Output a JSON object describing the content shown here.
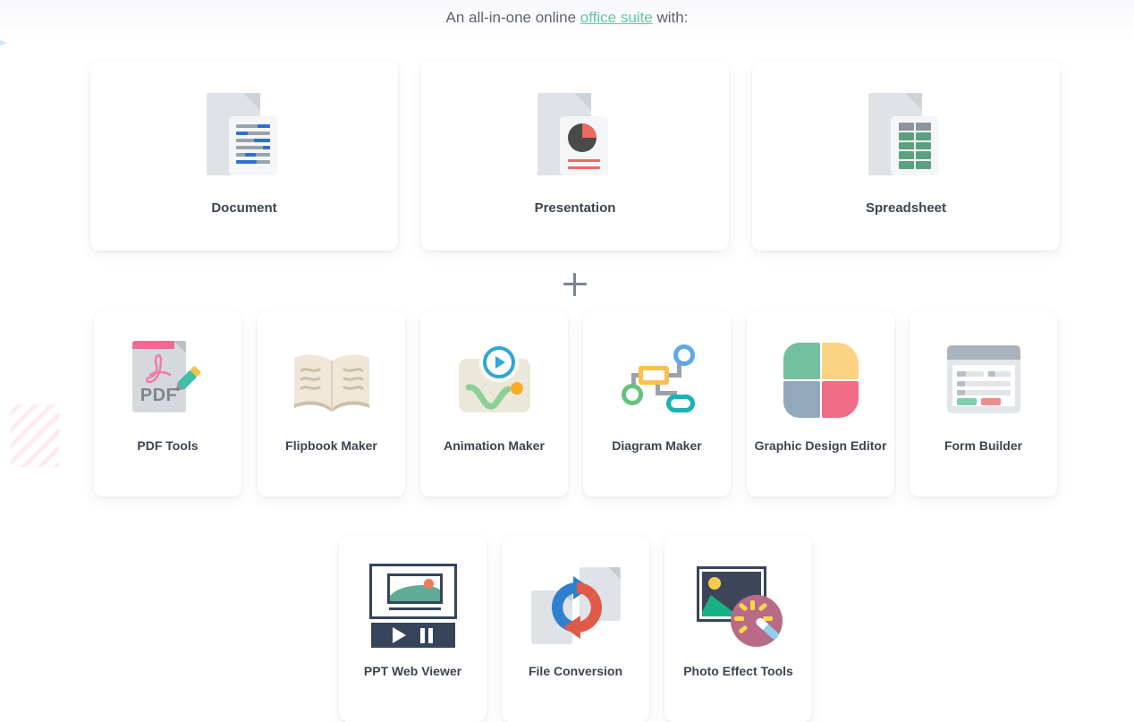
{
  "headline": {
    "prefix": "An all-in-one online ",
    "link": "office suite",
    "suffix": " with:"
  },
  "divider": {
    "plus_label": "+"
  },
  "primary_apps": [
    {
      "label": "Document",
      "icon": "document-icon"
    },
    {
      "label": "Presentation",
      "icon": "presentation-icon"
    },
    {
      "label": "Spreadsheet",
      "icon": "spreadsheet-icon"
    }
  ],
  "tool_apps": [
    {
      "label": "PDF Tools",
      "icon": "pdf-tools-icon"
    },
    {
      "label": "Flipbook Maker",
      "icon": "flipbook-icon"
    },
    {
      "label": "Animation Maker",
      "icon": "animation-icon"
    },
    {
      "label": "Diagram Maker",
      "icon": "diagram-icon"
    },
    {
      "label": "Graphic Design Editor",
      "icon": "graphic-design-icon"
    },
    {
      "label": "Form Builder",
      "icon": "form-builder-icon"
    }
  ],
  "extra_apps": [
    {
      "label": "PPT Web Viewer",
      "icon": "ppt-web-viewer-icon"
    },
    {
      "label": "File Conversion",
      "icon": "file-conversion-icon"
    },
    {
      "label": "Photo Effect Tools",
      "icon": "photo-effect-icon"
    }
  ],
  "pdf_icon": {
    "text": "PDF"
  },
  "colors": {
    "link_green": "#5fc8a6",
    "label_slate": "#3d4450",
    "headline_gray": "#5f6368",
    "doc_blue": "#2f6fd0",
    "presentation_red": "#ec6a5e",
    "spreadsheet_green": "#5aa17f",
    "pdf_pink": "#ef6a94",
    "pencil_teal": "#3fbfa4",
    "animation_blue": "#2fa5d8",
    "animation_orange": "#f6ab26",
    "diagram_yellow": "#fbc04c",
    "diagram_blue": "#61a8e8",
    "diagram_green": "#64c37d",
    "diagram_teal": "#19b3b7",
    "petal_green": "#74bfa0",
    "petal_yellow": "#fcd283",
    "petal_bluegray": "#92a9bd",
    "petal_pink": "#ef6b86",
    "viewer_navy": "#36445c",
    "convert_blue": "#2f7fd0",
    "convert_red": "#e05a4a",
    "photo_mauve": "#b96a86"
  }
}
